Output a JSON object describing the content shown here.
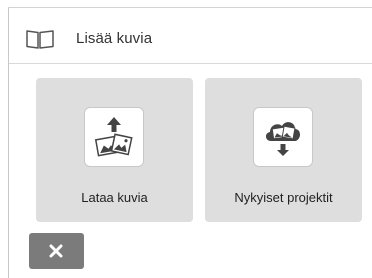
{
  "dialog": {
    "title": "Lisää kuvia",
    "title_icon": "photos-icon"
  },
  "options": [
    {
      "label": "Lataa kuvia",
      "icon": "upload-photos-icon"
    },
    {
      "label": "Nykyiset projektit",
      "icon": "cloud-download-icon"
    }
  ],
  "close": {
    "icon": "close-icon",
    "color": "#7b7b7b"
  },
  "colors": {
    "tile_background": "#dedede",
    "icon_dark": "#444444"
  }
}
